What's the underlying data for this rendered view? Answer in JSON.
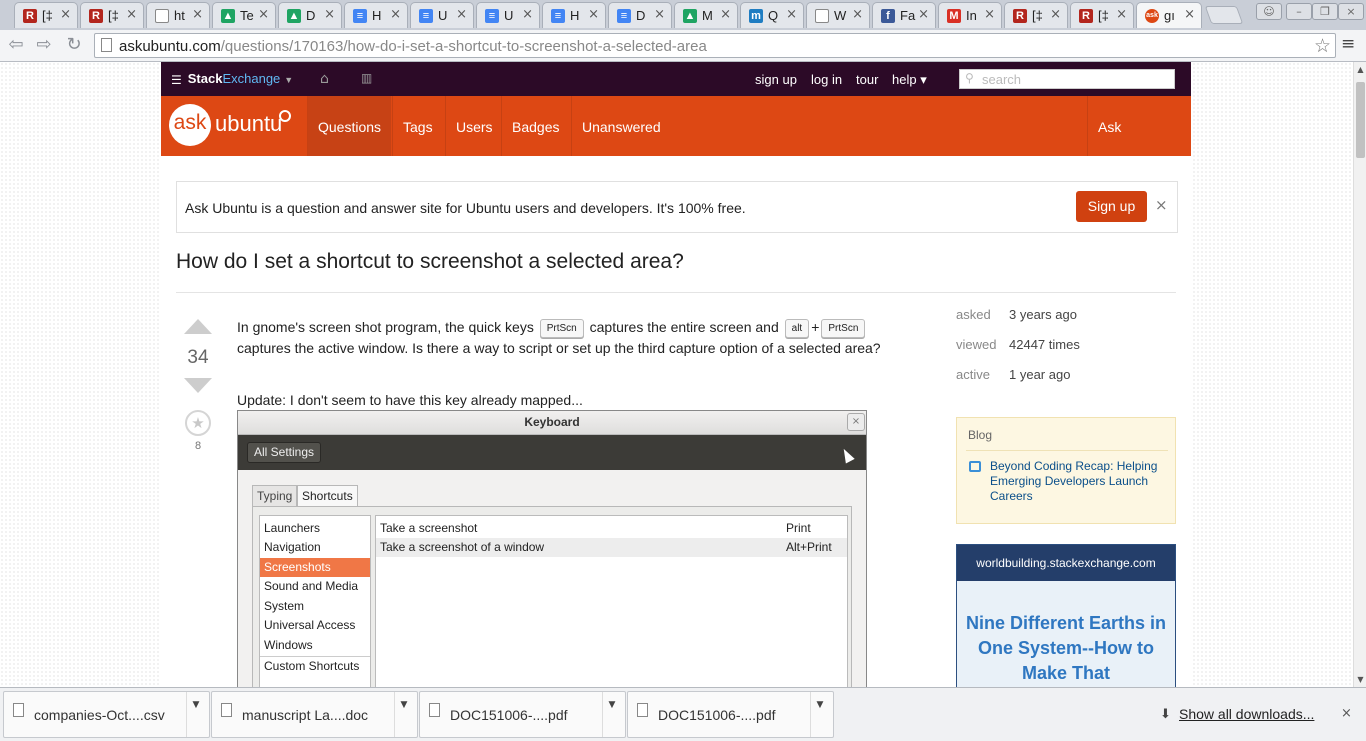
{
  "browser": {
    "tabs": [
      {
        "title": "[‡",
        "icon": "R",
        "icon_color": "#b3261e",
        "close": "×"
      },
      {
        "title": "[‡",
        "icon": "R",
        "icon_color": "#b3261e",
        "close": "×"
      },
      {
        "title": "ht",
        "icon": "page",
        "icon_color": "#888888",
        "close": "×"
      },
      {
        "title": "Te",
        "icon": "drive",
        "icon_color": "#1fa463",
        "close": "×"
      },
      {
        "title": "D",
        "icon": "drive",
        "icon_color": "#1fa463",
        "close": "×"
      },
      {
        "title": "H",
        "icon": "docs",
        "icon_color": "#4285f4",
        "close": "×"
      },
      {
        "title": "U",
        "icon": "docs",
        "icon_color": "#4285f4",
        "close": "×"
      },
      {
        "title": "U",
        "icon": "docs",
        "icon_color": "#4285f4",
        "close": "×"
      },
      {
        "title": "H",
        "icon": "docs",
        "icon_color": "#4285f4",
        "close": "×"
      },
      {
        "title": "D",
        "icon": "docs",
        "icon_color": "#4285f4",
        "close": "×"
      },
      {
        "title": "M",
        "icon": "drive",
        "icon_color": "#1fa463",
        "close": "×"
      },
      {
        "title": "Q",
        "icon": "m",
        "icon_color": "#1f7dc2",
        "close": "×"
      },
      {
        "title": "W",
        "icon": "page",
        "icon_color": "#888888",
        "close": "×"
      },
      {
        "title": "Fa",
        "icon": "f",
        "icon_color": "#3b5998",
        "close": "×"
      },
      {
        "title": "In",
        "icon": "M",
        "icon_color": "#d93025",
        "close": "×"
      },
      {
        "title": "[‡",
        "icon": "R",
        "icon_color": "#b3261e",
        "close": "×"
      },
      {
        "title": "[‡",
        "icon": "R",
        "icon_color": "#b3261e",
        "close": "×"
      },
      {
        "title": "gı",
        "icon": "ask",
        "icon_color": "#dd4814",
        "close": "×"
      }
    ],
    "url_host": "askubuntu.com",
    "url_path": "/questions/170163/how-do-i-set-a-shortcut-to-screenshot-a-selected-area"
  },
  "se_bar": {
    "logo_a": "Stack",
    "logo_b": "Exchange",
    "links": [
      "sign up",
      "log in",
      "tour",
      "help ▾"
    ],
    "search_placeholder": "search"
  },
  "au_header": {
    "logo_bubble": "ask",
    "logo_word": "ubuntu",
    "nav": [
      "Questions",
      "Tags",
      "Users",
      "Badges",
      "Unanswered"
    ],
    "ask_question": "Ask Question"
  },
  "banner": {
    "text": "Ask Ubuntu is a question and answer site for Ubuntu users and developers. It's 100% free.",
    "signup": "Sign up",
    "close": "×"
  },
  "question": {
    "title": "How do I set a shortcut to screenshot a selected area?",
    "votes": "34",
    "favorites": "8",
    "body_1": "In gnome's screen shot program, the quick keys",
    "kbd_1": "PrtScn",
    "body_2": "captures the entire screen and",
    "kbd_2": "alt",
    "plus": "+",
    "kbd_3": "PrtScn",
    "body_3": "captures the active window. Is there a way to script or set up the third capture option of a selected area?",
    "update": "Update: I don't seem to have this key already mapped..."
  },
  "keyboard_shot": {
    "title": "Keyboard",
    "all_settings": "All Settings",
    "tabs": [
      "Typing",
      "Shortcuts"
    ],
    "categories": [
      "Launchers",
      "Navigation",
      "Screenshots",
      "Sound and Media",
      "System",
      "Universal Access",
      "Windows",
      "Custom Shortcuts"
    ],
    "shortcuts": [
      {
        "action": "Take a screenshot",
        "key": "Print"
      },
      {
        "action": "Take a screenshot of a window",
        "key": "Alt+Print"
      }
    ]
  },
  "sidebar": {
    "meta": [
      {
        "label": "asked",
        "value": "3 years ago"
      },
      {
        "label": "viewed",
        "value": "42447 times"
      },
      {
        "label": "active",
        "value": "1 year ago"
      }
    ],
    "blog_heading": "Blog",
    "blog_post": "Beyond Coding Recap: Helping Emerging Developers Launch Careers",
    "ad_site": "worldbuilding.stackexchange.com",
    "ad_text": "Nine Different Earths in One System--How to Make That"
  },
  "downloads": {
    "items": [
      "companies-Oct....csv",
      "manuscript La....doc",
      "DOC151006-....pdf",
      "DOC151006-....pdf"
    ],
    "show_all": "Show all downloads...",
    "close": "×"
  },
  "colors": {
    "brand": "#dd4814",
    "topbar": "#2c0a27",
    "selected": "#f07746"
  }
}
